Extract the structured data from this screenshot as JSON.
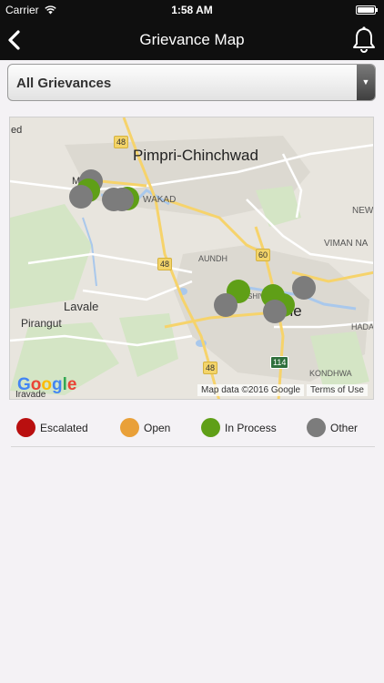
{
  "status_bar": {
    "carrier": "Carrier",
    "time": "1:58 AM"
  },
  "nav": {
    "title": "Grievance Map"
  },
  "filter": {
    "selected": "All Grievances"
  },
  "colors": {
    "escalated": "#b90f0f",
    "open": "#e9a038",
    "in_process": "#5f9f17",
    "other": "#7c7c7c"
  },
  "map": {
    "cities": {
      "pimpri": "Pimpri-Chinchwad",
      "lavale": "Lavale",
      "pirangut": "Pirangut",
      "pune": "Pune"
    },
    "places": {
      "ed": "ed",
      "maruji": "Maruji",
      "wakad": "WAKAD",
      "new": "NEW",
      "viman": "VIMAN NA",
      "aundh": "AUNDH",
      "hada": "HADA",
      "kondhwa": "KONDHWA",
      "iravade": "Iravade",
      "shiva": "SHIVA"
    },
    "shields": {
      "r48a": "48",
      "r48b": "48",
      "r48c": "48",
      "r60": "60",
      "r114": "114"
    },
    "google_logo": {
      "g": "G",
      "o1": "o",
      "o2": "o",
      "g2": "g",
      "l": "l",
      "e": "e"
    },
    "attribution": "Map data ©2016 Google",
    "terms": "Terms of Use"
  },
  "legend": {
    "escalated": "Escalated",
    "open": "Open",
    "in_process": "In Process",
    "other": "Other"
  }
}
